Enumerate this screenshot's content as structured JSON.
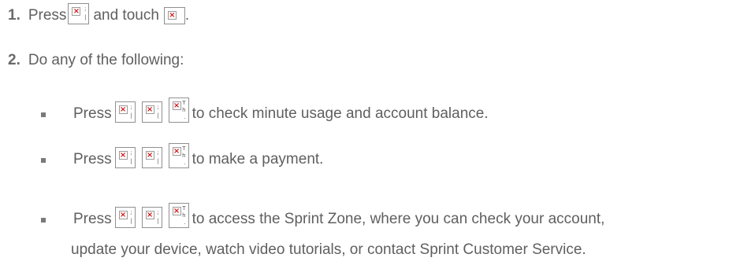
{
  "steps": [
    {
      "number": "1.",
      "text_before": "Press",
      "text_middle": "and touch",
      "text_after": "."
    },
    {
      "number": "2.",
      "text": "Do any of the following:"
    }
  ],
  "bullets": [
    {
      "prefix": "Press",
      "suffix": "to check minute usage and account balance."
    },
    {
      "prefix": "Press",
      "suffix": "to make a payment."
    },
    {
      "prefix": "Press",
      "suffix": "to access the Sprint Zone, where you can check your account,",
      "continuation": "update your device, watch video tutorials, or contact Sprint Customer Service."
    }
  ],
  "icons": {
    "broken_image": "broken-image-icon",
    "x_glyph": "×",
    "tick_a": ";",
    "tick_b": "|",
    "tick_t": "T",
    "tick_h": "h",
    "tick_dot": "."
  },
  "colors": {
    "text": "#5f5f5f",
    "broken_x": "#d01818",
    "icon_border": "#909090"
  }
}
